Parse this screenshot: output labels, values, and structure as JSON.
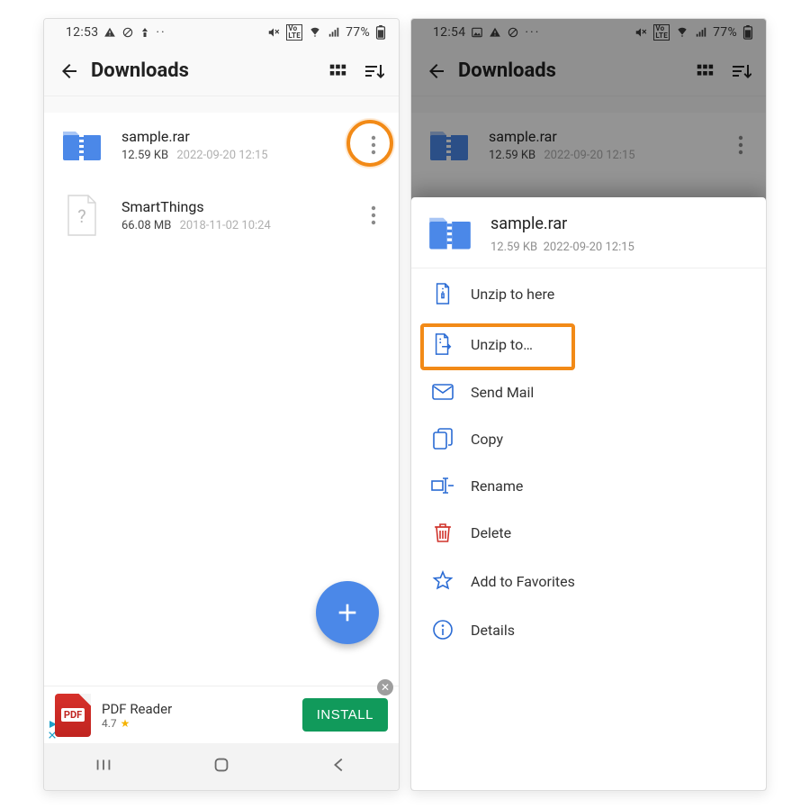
{
  "left": {
    "status": {
      "time": "12:53",
      "battery": "77%"
    },
    "appbar": {
      "title": "Downloads"
    },
    "files": [
      {
        "name": "sample.rar",
        "size": "12.59 KB",
        "date": "2022-09-20 12:15",
        "icon": "zip"
      },
      {
        "name": "SmartThings",
        "size": "66.08 MB",
        "date": "2018-11-02 10:24",
        "icon": "unknown"
      }
    ],
    "ad": {
      "title": "PDF Reader",
      "rating": "4.7",
      "cta": "INSTALL",
      "badge": "PDF"
    }
  },
  "right": {
    "status": {
      "time": "12:54",
      "battery": "77%"
    },
    "appbar": {
      "title": "Downloads"
    },
    "file": {
      "name": "sample.rar",
      "size": "12.59 KB",
      "date": "2022-09-20 12:15"
    },
    "sheet": {
      "file": {
        "name": "sample.rar",
        "size": "12.59 KB",
        "date": "2022-09-20 12:15"
      },
      "items": [
        {
          "label": "Unzip to here",
          "icon": "unzip-here"
        },
        {
          "label": "Unzip to…",
          "icon": "unzip-to"
        },
        {
          "label": "Send Mail",
          "icon": "mail"
        },
        {
          "label": "Copy",
          "icon": "copy"
        },
        {
          "label": "Rename",
          "icon": "rename"
        },
        {
          "label": "Delete",
          "icon": "delete"
        },
        {
          "label": "Add to Favorites",
          "icon": "star"
        },
        {
          "label": "Details",
          "icon": "info"
        }
      ],
      "highlightIndex": 1
    }
  }
}
